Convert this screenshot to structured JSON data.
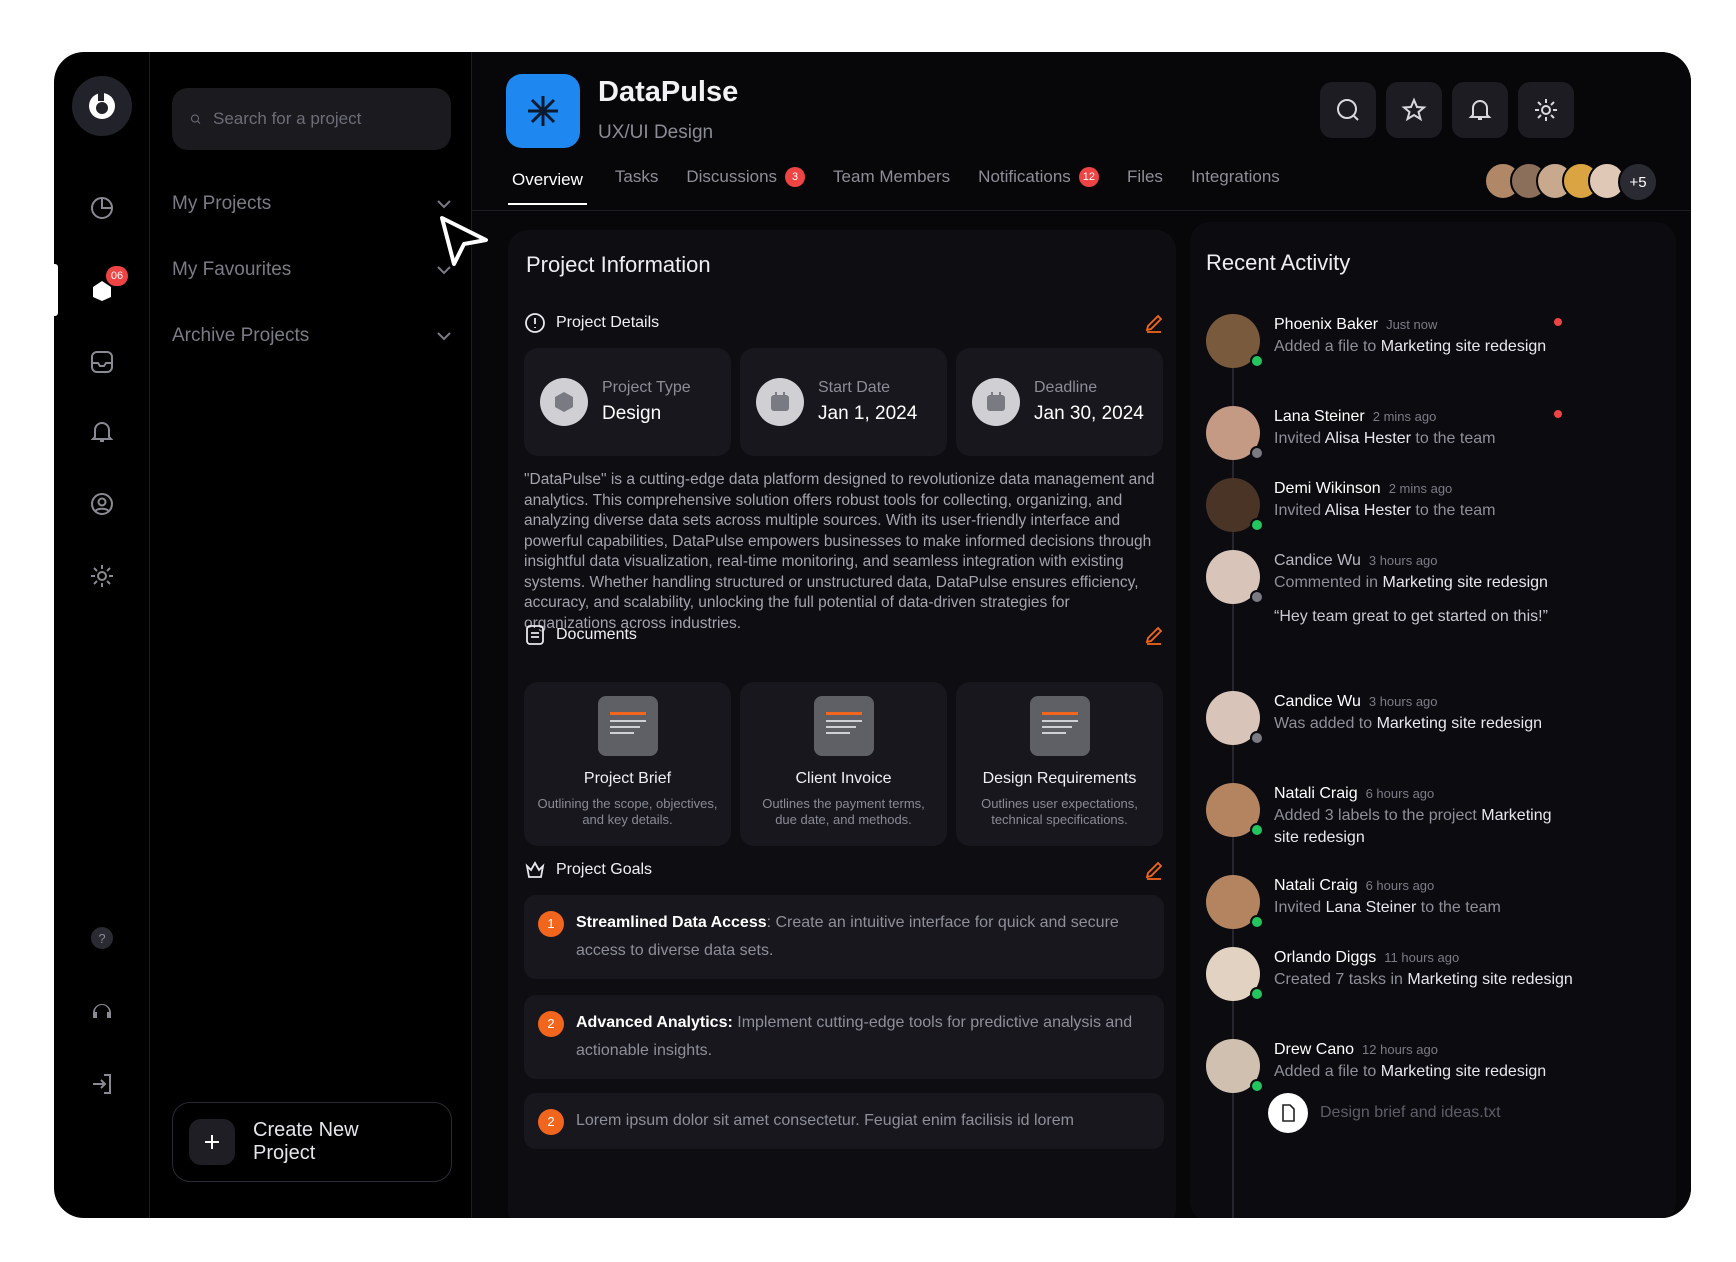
{
  "rail": {
    "badge": "06"
  },
  "sidebar": {
    "search_placeholder": "Search for a project",
    "items": [
      {
        "label": "My Projects"
      },
      {
        "label": "My Favourites"
      },
      {
        "label": "Archive Projects"
      }
    ],
    "create_label": "Create New Project"
  },
  "header": {
    "title": "DataPulse",
    "subtitle": "UX/UI Design",
    "tabs": [
      {
        "label": "Overview"
      },
      {
        "label": "Tasks"
      },
      {
        "label": "Discussions",
        "badge": "3"
      },
      {
        "label": "Team Members"
      },
      {
        "label": "Notifications",
        "badge": "12"
      },
      {
        "label": "Files"
      },
      {
        "label": "Integrations"
      }
    ],
    "members_more": "+5"
  },
  "info": {
    "title": "Project Information",
    "details_heading": "Project Details",
    "details": [
      {
        "label": "Project Type",
        "value": "Design"
      },
      {
        "label": "Start Date",
        "value": "Jan 1, 2024"
      },
      {
        "label": "Deadline",
        "value": "Jan 30, 2024"
      }
    ],
    "description": "\"DataPulse\" is a cutting-edge data platform designed to revolutionize data management and analytics. This comprehensive solution offers robust tools for collecting, organizing, and analyzing diverse data sets across multiple sources. With its user-friendly interface and powerful capabilities, DataPulse empowers businesses to make informed decisions through insightful data visualization, real-time monitoring, and seamless integration with existing systems. Whether handling structured or unstructured data, DataPulse ensures efficiency, accuracy, and scalability, unlocking the full potential of data-driven strategies for organizations across industries.",
    "documents_heading": "Documents",
    "documents": [
      {
        "title": "Project Brief",
        "desc": "Outlining the scope, objectives, and key details."
      },
      {
        "title": "Client Invoice",
        "desc": "Outlines the payment terms, due date, and methods."
      },
      {
        "title": "Design Requirements",
        "desc": "Outlines user expectations, technical specifications."
      }
    ],
    "goals_heading": "Project Goals",
    "goals": [
      {
        "num": "1",
        "title": "Streamlined Data Access",
        "text": ": Create an intuitive interface for quick and secure access to diverse data sets."
      },
      {
        "num": "2",
        "title": "Advanced Analytics:",
        "text": " Implement cutting-edge tools for predictive analysis and actionable insights."
      },
      {
        "num": "2",
        "title": "",
        "text": "Lorem ipsum dolor sit amet consectetur. Feugiat enim facilisis id lorem"
      }
    ]
  },
  "activity": {
    "title": "Recent Activity",
    "items": [
      {
        "name": "Phoenix Baker",
        "time": "Just now",
        "pre": "Added a file to ",
        "target": "Marketing site redesign",
        "post": ""
      },
      {
        "name": "Lana Steiner",
        "time": "2 mins ago",
        "pre": "Invited ",
        "target": "Alisa Hester",
        "post": " to the team"
      },
      {
        "name": "Demi Wikinson",
        "time": "2 mins ago",
        "pre": "Invited ",
        "target": "Alisa Hester",
        "post": " to the team"
      },
      {
        "name": "Candice Wu",
        "time": "3 hours ago",
        "pre": "Commented in ",
        "target": "Marketing site redesign",
        "post": "",
        "quote": "“Hey team great to get started on this!”"
      },
      {
        "name": "Candice Wu",
        "time": "3 hours ago",
        "pre": "Was added to ",
        "target": "Marketing site redesign",
        "post": ""
      },
      {
        "name": "Natali Craig",
        "time": "6 hours ago",
        "pre": "Added 3 labels to the project ",
        "target": "Marketing site redesign",
        "post": ""
      },
      {
        "name": "Natali Craig",
        "time": "6 hours ago",
        "pre": "Invited ",
        "target": "Lana Steiner",
        "post": " to the team"
      },
      {
        "name": "Orlando Diggs",
        "time": "11 hours ago",
        "pre": "Created 7 tasks in ",
        "target": "Marketing site redesign",
        "post": ""
      },
      {
        "name": "Drew Cano",
        "time": "12 hours ago",
        "pre": "Added a file to ",
        "target": "Marketing site redesign",
        "post": "",
        "file": "Design brief and ideas.txt"
      }
    ]
  },
  "colors": {
    "accent": "#1e88f0",
    "goal_number": "#f2651d",
    "badge": "#ef4444",
    "online": "#22c55e"
  }
}
